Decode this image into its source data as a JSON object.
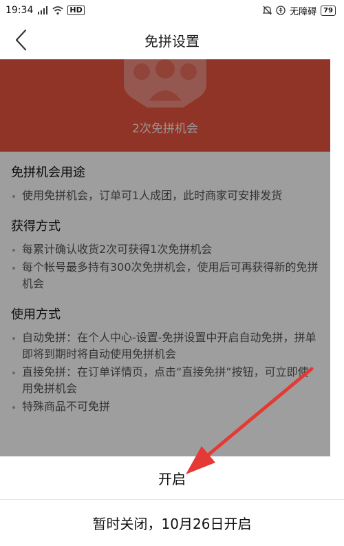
{
  "status_bar": {
    "time": "19:34",
    "network": "4G",
    "wifi": "wifi",
    "hd": "HD",
    "accessibility": "无障碍",
    "battery": "79"
  },
  "nav": {
    "title": "免拼设置"
  },
  "hero": {
    "text": "2次免拼机会",
    "color": "#e8543f"
  },
  "sections": [
    {
      "title": "免拼机会用途",
      "items": [
        "使用免拼机会，订单可1人成团，此时商家可安排发货"
      ]
    },
    {
      "title": "获得方式",
      "items": [
        "每累计确认收货2次可获得1次免拼机会",
        "每个帐号最多持有300次免拼机会，使用后可再获得新的免拼机会"
      ]
    },
    {
      "title": "使用方式",
      "items": [
        "自动免拼：在个人中心-设置-免拼设置中开启自动免拼，拼单即将到期时将自动使用免拼机会",
        "直接免拼：在订单详情页，点击“直接免拼”按钮，可立即使用免拼机会",
        "特殊商品不可免拼"
      ]
    }
  ],
  "sheet": {
    "option_open": "开启",
    "option_close_temp": "暂时关闭，10月26日开启"
  },
  "annotation_arrow_color": "#e53935"
}
